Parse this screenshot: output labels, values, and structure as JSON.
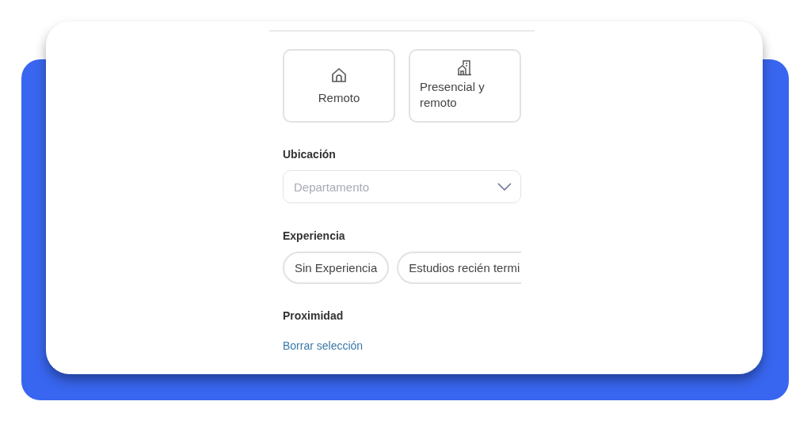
{
  "modality_options": [
    {
      "label": "Remoto",
      "kind": "house",
      "selected": false
    },
    {
      "label": "Presencial y remoto",
      "kind": "building",
      "selected": false
    }
  ],
  "location": {
    "label": "Ubicación",
    "placeholder": "Departamento"
  },
  "experience": {
    "label": "Experiencia",
    "chips": [
      {
        "label": "Sin Experiencia",
        "selected": false
      },
      {
        "label": "Estudios recién termi",
        "selected": false
      }
    ]
  },
  "proximity": {
    "label": "Proximidad"
  },
  "clear_link": "Borrar selección"
}
